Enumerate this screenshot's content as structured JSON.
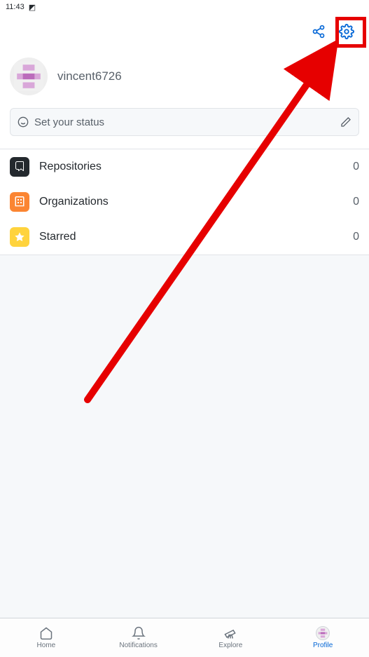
{
  "statusbar": {
    "time": "11:43"
  },
  "profile": {
    "username": "vincent6726",
    "status_placeholder": "Set your status"
  },
  "menu": {
    "repositories": {
      "label": "Repositories",
      "count": "0"
    },
    "organizations": {
      "label": "Organizations",
      "count": "0"
    },
    "starred": {
      "label": "Starred",
      "count": "0"
    }
  },
  "tabs": {
    "home": "Home",
    "notifications": "Notifications",
    "explore": "Explore",
    "profile": "Profile"
  }
}
